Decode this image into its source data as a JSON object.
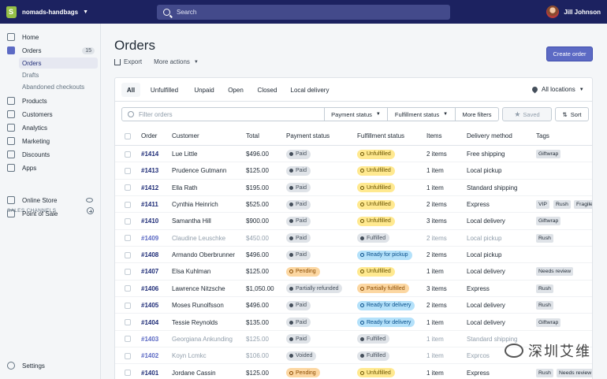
{
  "topbar": {
    "store_name": "nomads-handbags",
    "search_placeholder": "Search",
    "user_name": "Jill Johnson"
  },
  "sidebar": {
    "items": [
      {
        "label": "Home"
      },
      {
        "label": "Orders",
        "badge": "15"
      },
      {
        "label": "Products"
      },
      {
        "label": "Customers"
      },
      {
        "label": "Analytics"
      },
      {
        "label": "Marketing"
      },
      {
        "label": "Discounts"
      },
      {
        "label": "Apps"
      }
    ],
    "order_subitems": [
      "Orders",
      "Drafts",
      "Abandoned checkouts"
    ],
    "sales_channels_label": "SALES CHANNELS",
    "channels": [
      "Online Store",
      "Point of Sale"
    ],
    "settings": "Settings"
  },
  "header": {
    "title": "Orders",
    "export": "Export",
    "more_actions": "More actions",
    "create_order": "Create order"
  },
  "tabs": [
    "All",
    "Unfulfilled",
    "Unpaid",
    "Open",
    "Closed",
    "Local delivery"
  ],
  "location": "All locations",
  "filters": {
    "placeholder": "Filter orders",
    "payment_status": "Payment status",
    "fulfillment_status": "Fulfillment status",
    "more_filters": "More filters",
    "saved": "Saved",
    "sort": "Sort"
  },
  "columns": [
    "Order",
    "Customer",
    "Total",
    "Payment status",
    "Fulfillment status",
    "Items",
    "Delivery method",
    "Tags"
  ],
  "orders": [
    {
      "order": "#1414",
      "customer": "Lue Little",
      "total": "$496.00",
      "payment": "Paid",
      "fulfillment": "Unfulfilled",
      "items": "2 items",
      "delivery": "Free shipping",
      "tags": [
        "Giftwrap"
      ]
    },
    {
      "order": "#1413",
      "customer": "Prudence Gutmann",
      "total": "$125.00",
      "payment": "Paid",
      "fulfillment": "Unfulfilled",
      "items": "1 item",
      "delivery": "Local pickup",
      "tags": []
    },
    {
      "order": "#1412",
      "customer": "Ella Rath",
      "total": "$195.00",
      "payment": "Paid",
      "fulfillment": "Unfulfilled",
      "items": "1 item",
      "delivery": "Standard shipping",
      "tags": []
    },
    {
      "order": "#1411",
      "customer": "Cynthia Heinrich",
      "total": "$525.00",
      "payment": "Paid",
      "fulfillment": "Unfulfilled",
      "items": "2 items",
      "delivery": "Express",
      "tags": [
        "VIP",
        "Rush",
        "Fragile it"
      ]
    },
    {
      "order": "#1410",
      "customer": "Samantha Hill",
      "total": "$900.00",
      "payment": "Paid",
      "fulfillment": "Unfulfilled",
      "items": "3 items",
      "delivery": "Local delivery",
      "tags": [
        "Giftwrap"
      ]
    },
    {
      "order": "#1409",
      "customer": "Claudine Leuschke",
      "total": "$450.00",
      "payment": "Paid",
      "fulfillment": "Fulfilled",
      "items": "2 items",
      "delivery": "Local pickup",
      "tags": [
        "Rush"
      ],
      "muted": true
    },
    {
      "order": "#1408",
      "customer": "Armando Oberbrunner",
      "total": "$496.00",
      "payment": "Paid",
      "fulfillment": "Ready for pickup",
      "items": "2 items",
      "delivery": "Local pickup",
      "tags": []
    },
    {
      "order": "#1407",
      "customer": "Elsa Kuhlman",
      "total": "$125.00",
      "payment": "Pending",
      "fulfillment": "Unfulfilled",
      "items": "1 item",
      "delivery": "Local delivery",
      "tags": [
        "Needs review"
      ]
    },
    {
      "order": "#1406",
      "customer": "Lawrence Nitzsche",
      "total": "$1,050.00",
      "payment": "Partially refunded",
      "fulfillment": "Partially fulfilled",
      "items": "3 items",
      "delivery": "Express",
      "tags": [
        "Rush"
      ]
    },
    {
      "order": "#1405",
      "customer": "Moses Runolfsson",
      "total": "$496.00",
      "payment": "Paid",
      "fulfillment": "Ready for delivery",
      "items": "2 items",
      "delivery": "Local delivery",
      "tags": [
        "Rush"
      ]
    },
    {
      "order": "#1404",
      "customer": "Tessie Reynolds",
      "total": "$135.00",
      "payment": "Paid",
      "fulfillment": "Ready for delivery",
      "items": "1 item",
      "delivery": "Local delivery",
      "tags": [
        "Giftwrap"
      ]
    },
    {
      "order": "#1403",
      "customer": "Georgiana Ankunding",
      "total": "$125.00",
      "payment": "Paid",
      "fulfillment": "Fulfilled",
      "items": "1 item",
      "delivery": "Standard shipping",
      "tags": [],
      "muted": true
    },
    {
      "order": "#1402",
      "customer": "Koyn Lcmkc",
      "total": "$106.00",
      "payment": "Voided",
      "fulfillment": "Fulfilled",
      "items": "1 item",
      "delivery": "Exprcos",
      "tags": [],
      "muted": true
    },
    {
      "order": "#1401",
      "customer": "Jordane Cassin",
      "total": "$125.00",
      "payment": "Pending",
      "fulfillment": "Unfulfilled",
      "items": "1 item",
      "delivery": "Express",
      "tags": [
        "Rush",
        "Needs review"
      ]
    }
  ],
  "status_colors": {
    "Paid": {
      "bg": "#dfe3e8",
      "fg": "#454f5b"
    },
    "Pending": {
      "bg": "#fcd7a2",
      "fg": "#8a4b00"
    },
    "Partially refunded": {
      "bg": "#dfe3e8",
      "fg": "#454f5b"
    },
    "Voided": {
      "bg": "#dfe3e8",
      "fg": "#454f5b"
    },
    "Unfulfilled": {
      "bg": "#ffe990",
      "fg": "#6b5400"
    },
    "Fulfilled": {
      "bg": "#dfe3e8",
      "fg": "#454f5b"
    },
    "Ready for pickup": {
      "bg": "#b4e1fa",
      "fg": "#084e8a"
    },
    "Ready for delivery": {
      "bg": "#b4e1fa",
      "fg": "#084e8a"
    },
    "Partially fulfilled": {
      "bg": "#fcd7a2",
      "fg": "#8a4b00"
    }
  },
  "watermark": "深圳艾维"
}
